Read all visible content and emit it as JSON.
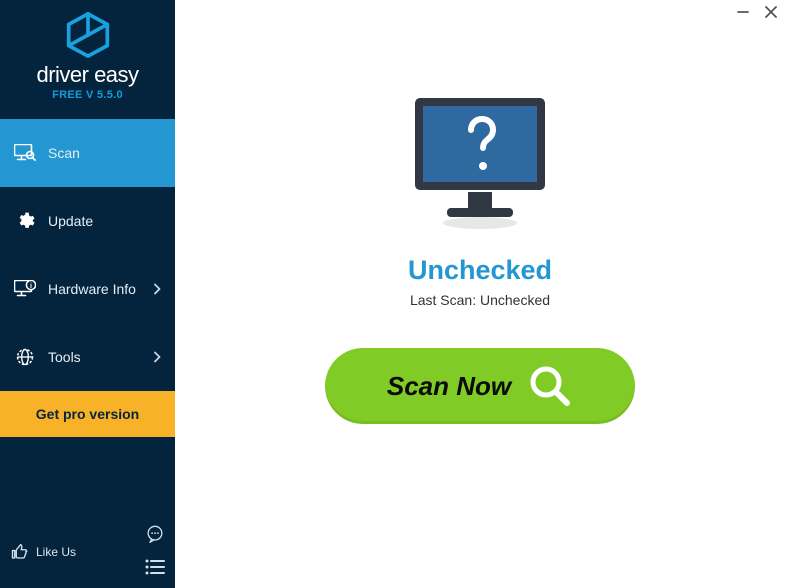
{
  "brand": {
    "name": "driver easy",
    "version": "FREE V 5.5.0"
  },
  "sidebar": {
    "items": [
      {
        "label": "Scan",
        "icon": "scan",
        "chevron": false,
        "active": true
      },
      {
        "label": "Update",
        "icon": "gear",
        "chevron": false,
        "active": false
      },
      {
        "label": "Hardware Info",
        "icon": "hardware",
        "chevron": true,
        "active": false
      },
      {
        "label": "Tools",
        "icon": "tools",
        "chevron": true,
        "active": false
      }
    ],
    "pro_label": "Get pro version",
    "like_us": "Like Us"
  },
  "main": {
    "status_title": "Unchecked",
    "last_scan": "Last Scan: Unchecked",
    "scan_button": "Scan Now"
  },
  "colors": {
    "accent": "#2496d2",
    "sidebar_bg": "#04243d",
    "pro_bg": "#f7b227",
    "scan_btn": "#80cb25",
    "monitor_screen": "#2e6aa0"
  }
}
